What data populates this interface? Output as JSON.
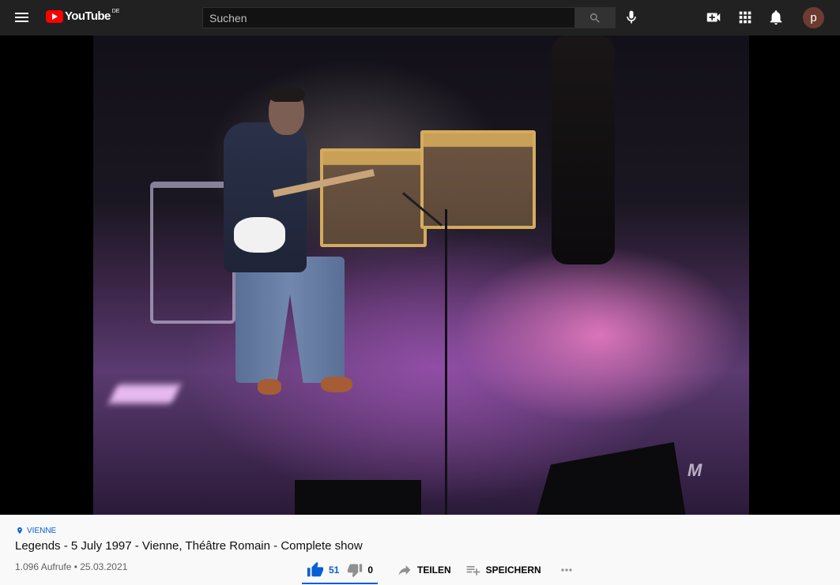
{
  "header": {
    "logo_text": "YouTube",
    "logo_region": "DE",
    "search_placeholder": "Suchen",
    "avatar_letter": "p"
  },
  "video": {
    "watermark_text": "M"
  },
  "info": {
    "location": "VIENNE",
    "title": "Legends - 5 July 1997 - Vienne, Théâtre Romain - Complete show",
    "views_date": "1.096 Aufrufe • 25.03.2021"
  },
  "actions": {
    "like_count": "51",
    "dislike_count": "0",
    "share_label": "TEILEN",
    "save_label": "SPEICHERN",
    "like_ratio": 1.0
  },
  "colors": {
    "accent": "#065fd4",
    "header_bg": "#212121",
    "logo_red": "#ff0000"
  }
}
